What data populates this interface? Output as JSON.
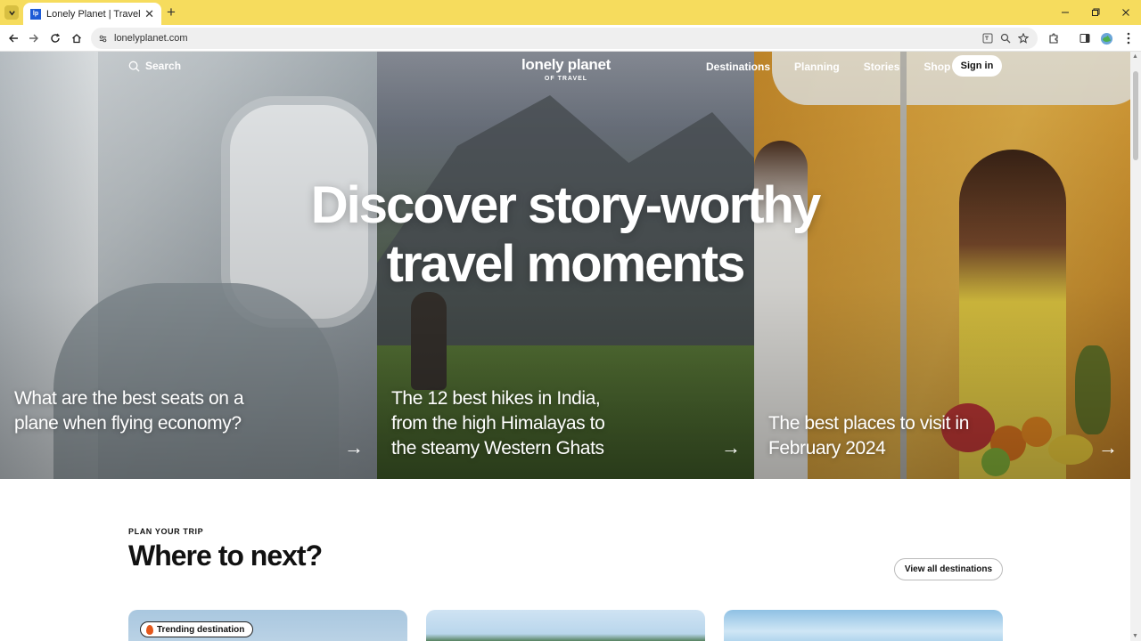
{
  "browser": {
    "tab_title": "Lonely Planet | Travel Guides &",
    "favicon_text": "lp",
    "url": "lonelyplanet.com",
    "tab_close": "✕",
    "new_tab": "+"
  },
  "site": {
    "search_label": "Search",
    "logo_text": "lonely planet",
    "logo_tagline": "OF TRAVEL",
    "nav_links": [
      "Destinations",
      "Planning",
      "Stories",
      "Shop"
    ],
    "signin_label": "Sign in"
  },
  "hero": {
    "headline_line1": "Discover story-worthy",
    "headline_line2": "travel moments",
    "stories": [
      {
        "title": "What are the best seats on a plane when flying economy?"
      },
      {
        "title": "The 12 best hikes in India, from the high Himalayas to the steamy Western Ghats"
      },
      {
        "title": "The best places to visit in February 2024"
      }
    ],
    "arrow": "→"
  },
  "plan": {
    "eyebrow": "PLAN YOUR TRIP",
    "title": "Where to next?",
    "view_all_label": "View all destinations",
    "trending_label": "Trending destination"
  },
  "colors": {
    "chrome_tabbar": "#f6dc5d",
    "accent_text": "#111111"
  }
}
